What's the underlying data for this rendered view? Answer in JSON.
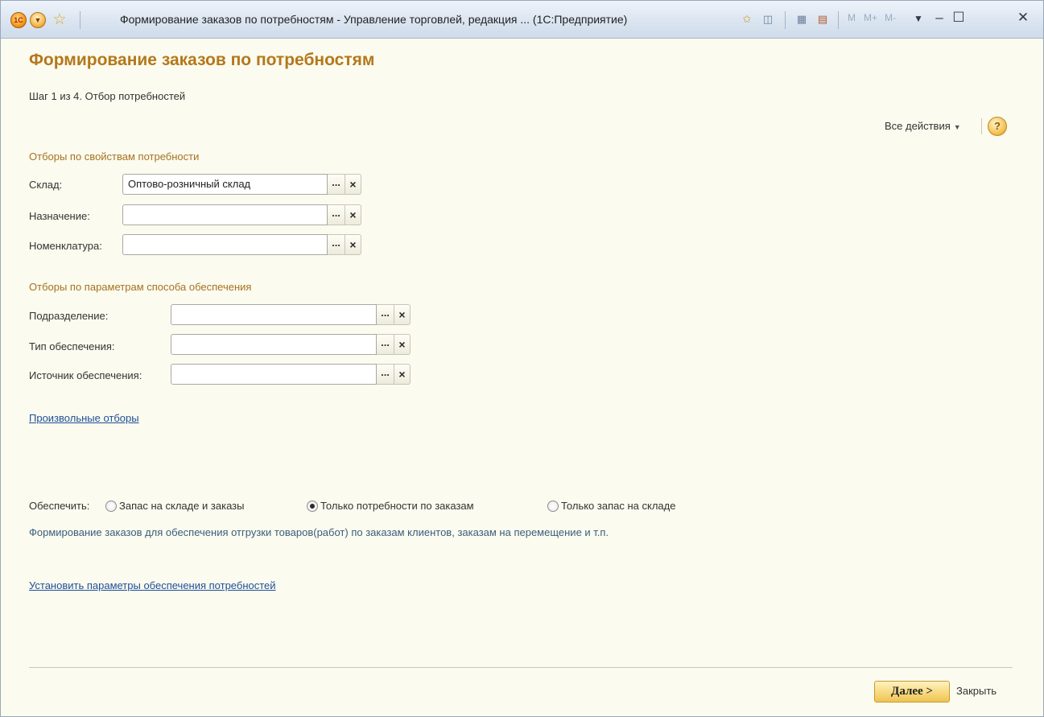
{
  "window": {
    "title": "Формирование заказов по потребностям - Управление торговлей, редакция ... (1С:Предприятие)",
    "logo_text": "1С",
    "m_buttons": [
      "M",
      "M+",
      "M-"
    ]
  },
  "form": {
    "heading": "Формирование заказов по потребностям",
    "step": "Шаг 1 из 4. Отбор потребностей",
    "all_actions": "Все действия",
    "help": "?"
  },
  "section1": {
    "title": "Отборы по свойствам потребности",
    "fields": [
      {
        "label": "Склад:",
        "value": "Оптово-розничный склад"
      },
      {
        "label": "Назначение:",
        "value": ""
      },
      {
        "label": "Номенклатура:",
        "value": ""
      }
    ]
  },
  "section2": {
    "title": "Отборы по параметрам способа обеспечения",
    "fields": [
      {
        "label": "Подразделение:",
        "value": ""
      },
      {
        "label": "Тип обеспечения:",
        "value": ""
      },
      {
        "label": "Источник обеспечения:",
        "value": ""
      }
    ]
  },
  "custom_filters_link": "Произвольные отборы",
  "provide": {
    "label": "Обеспечить:",
    "options": [
      {
        "label": "Запас на складе и заказы",
        "selected": false
      },
      {
        "label": "Только потребности по заказам",
        "selected": true
      },
      {
        "label": "Только запас на складе",
        "selected": false
      }
    ],
    "description": "Формирование заказов для обеспечения отгрузки товаров(работ) по заказам клиентов, заказам на перемещение и т.п."
  },
  "set_params_link": "Установить параметры обеспечения потребностей",
  "footer": {
    "next": "Далее >",
    "close": "Закрыть"
  },
  "field_button_select": "...",
  "field_button_clear": "×",
  "colors": {
    "heading": "#b4781a",
    "section": "#a6731f",
    "link": "#1f4f9a",
    "background": "#fbfbef"
  }
}
